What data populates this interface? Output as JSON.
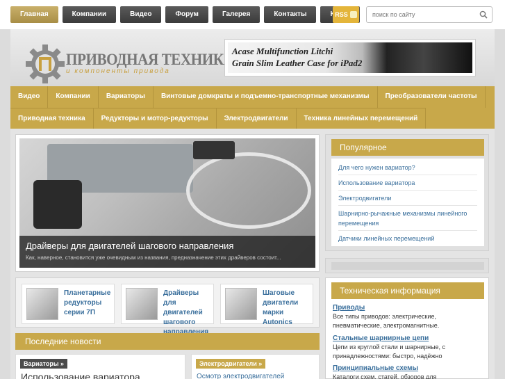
{
  "topnav": {
    "items": [
      "Главная",
      "Компании",
      "Видео",
      "Форум",
      "Галерея",
      "Контакты",
      "Карта"
    ],
    "active": 0
  },
  "rss": {
    "label": "RSS"
  },
  "search": {
    "placeholder": "поиск по сайту"
  },
  "logo": {
    "title": "ПРИВОДНАЯ ТЕХНИКА",
    "subtitle": "и компоненты привода"
  },
  "banner": {
    "line1": "Acase Multifunction Litchi",
    "line2": "Grain Slim Leather Case for iPad2"
  },
  "catnav": {
    "row1": [
      "Видео",
      "Компании",
      "Вариаторы",
      "Винтовые домкраты и подъемно-транспортные механизмы",
      "Преобразователи частоты"
    ],
    "row2": [
      "Приводная техника",
      "Редукторы и мотор-редукторы",
      "Электродвигатели",
      "Техника линейных перемещений"
    ]
  },
  "slider": {
    "title": "Драйверы для двигателей шагового направления",
    "description": "Как, наверное, становится уже очевидным из названия, предназначение этих драйверов состоит..."
  },
  "thumbs": [
    {
      "label": "Планетарные редукторы серии 7П"
    },
    {
      "label": "Драйверы для двигателей шагового направления"
    },
    {
      "label": "Шаговые двигатели марки Autonics"
    }
  ],
  "news": {
    "header": "Последние новости",
    "col1": {
      "tag": "Вариаторы »",
      "title": "Использование вариатора"
    },
    "col2": {
      "tag": "Электродвигатели »",
      "title": "Осмотр электродвигателей"
    }
  },
  "popular": {
    "header": "Популярное",
    "items": [
      "Для чего нужен вариатор?",
      "Использование вариатора",
      "Электродвигатели",
      "Шарнирно-рычажные механизмы линейного перемещения",
      "Датчики линейных перемещений"
    ]
  },
  "tech": {
    "header": "Техническая информация",
    "items": [
      {
        "title": "Приводы",
        "desc": "Все типы приводов: электрические, пневматические, электромагнитные."
      },
      {
        "title": "Стальные шарнирные цепи",
        "desc": "Цепи из круглой стали и шарнирные, с принадлежностями: быстро, надёжно"
      },
      {
        "title": "Принципиальные схемы",
        "desc": "Каталоги схем, статей, обзоров для"
      }
    ]
  },
  "colors": {
    "gold": "#c8a84a",
    "dark_nav": "#3b3b3b",
    "link": "#3a6f9c"
  }
}
